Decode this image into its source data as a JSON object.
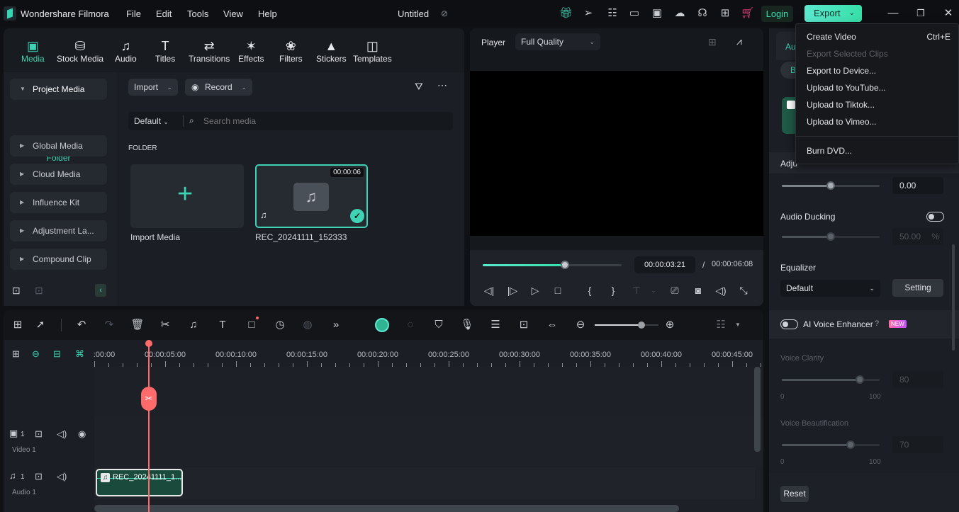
{
  "titlebar": {
    "app_name": "Wondershare Filmora",
    "menus": [
      "File",
      "Edit",
      "Tools",
      "View",
      "Help"
    ],
    "project_title": "Untitled",
    "login_label": "Login",
    "export_label": "Export",
    "icons": [
      "gift-icon",
      "send-icon",
      "task-list-icon",
      "layout-icon",
      "save-icon",
      "cloud-upload-icon",
      "headset-icon",
      "apps-grid-icon",
      "cart-icon"
    ],
    "accent_color": "#3ed3b4"
  },
  "media_tabs": [
    {
      "label": "Media",
      "icon": "media-icon",
      "active": true
    },
    {
      "label": "Stock Media",
      "icon": "stock-media-icon"
    },
    {
      "label": "Audio",
      "icon": "audio-note-icon"
    },
    {
      "label": "Titles",
      "icon": "titles-t-icon"
    },
    {
      "label": "Transitions",
      "icon": "transitions-icon"
    },
    {
      "label": "Effects",
      "icon": "effects-star-icon"
    },
    {
      "label": "Filters",
      "icon": "filters-icon"
    },
    {
      "label": "Stickers",
      "icon": "stickers-icon"
    },
    {
      "label": "Templates",
      "icon": "templates-icon"
    }
  ],
  "sidebar": {
    "project_media": "Project Media",
    "folder": "Folder",
    "items": [
      "Global Media",
      "Cloud Media",
      "Influence Kit",
      "Adjustment La...",
      "Compound Clip"
    ]
  },
  "media": {
    "import_label": "Import",
    "record_label": "Record",
    "sort_label": "Default",
    "search_placeholder": "Search media",
    "section_label": "FOLDER",
    "import_card_label": "Import Media",
    "clip": {
      "name": "REC_20241111_152333",
      "duration": "00:00:06"
    }
  },
  "player": {
    "label": "Player",
    "quality": "Full Quality",
    "current_time": "00:00:03:21",
    "separator": "/",
    "total_time": "00:00:06:08",
    "progress_fraction": 0.59
  },
  "export_menu": {
    "items": [
      {
        "label": "Create Video",
        "shortcut": "Ctrl+E",
        "disabled": false
      },
      {
        "label": "Export Selected Clips",
        "disabled": true
      },
      {
        "label": "Export to Device...",
        "disabled": false
      },
      {
        "label": "Upload to YouTube...",
        "disabled": false
      },
      {
        "label": "Upload to Tiktok...",
        "disabled": false
      },
      {
        "label": "Upload to Vimeo...",
        "disabled": false
      },
      {
        "label": "Burn DVD...",
        "disabled": false
      }
    ]
  },
  "right_panel": {
    "tab_partial": "Au",
    "pill_partial": "B",
    "adjust_partial": "Adju",
    "pitch_value": "0.00",
    "pitch_fraction": 0.5,
    "audio_ducking_label": "Audio Ducking",
    "audio_ducking_on": false,
    "ducking_value": "50.00",
    "ducking_unit": "%",
    "ducking_fraction": 0.5,
    "equalizer_label": "Equalizer",
    "equalizer_value": "Default",
    "setting_label": "Setting",
    "ai_voice_label": "AI Voice Enhancer",
    "ai_voice_on": false,
    "new_badge": "NEW",
    "voice_clarity_label": "Voice Clarity",
    "voice_clarity_value": "80",
    "voice_beautification_label": "Voice Beautification",
    "voice_beautification_value": "70",
    "range_min": "0",
    "range_max": "100",
    "reset_label": "Reset"
  },
  "timeline": {
    "ruler_labels": [
      ":00:00",
      "00:00:05:00",
      "00:00:10:00",
      "00:00:15:00",
      "00:00:20:00",
      "00:00:25:00",
      "00:00:30:00",
      "00:00:35:00",
      "00:00:40:00",
      "00:00:45:00"
    ],
    "tracks": [
      {
        "name": "Video 1",
        "index": "1"
      },
      {
        "name": "Audio 1",
        "index": "1"
      }
    ],
    "audio_clip_name": "REC_20241111_1...",
    "zoom_fraction": 0.74
  }
}
